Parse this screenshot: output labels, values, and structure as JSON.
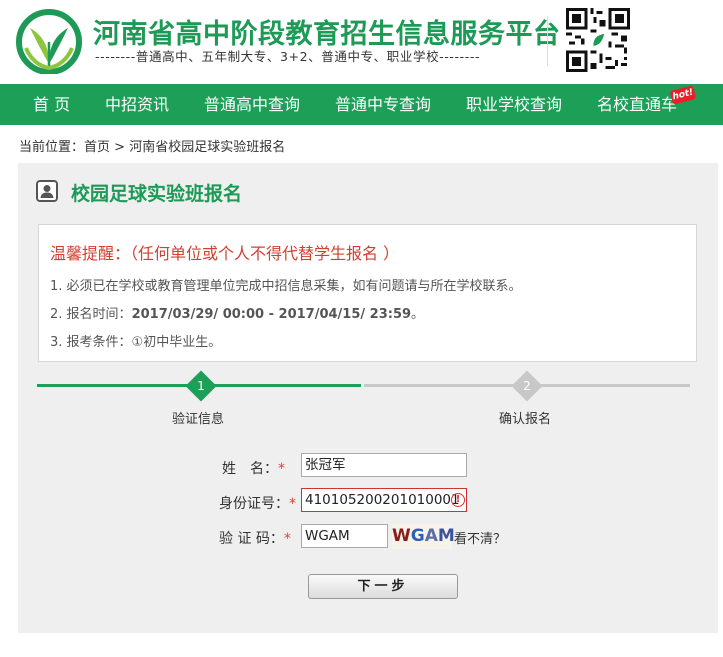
{
  "header": {
    "title": "河南省高中阶段教育招生信息服务平台",
    "subtitle": "--------普通高中、五年制大专、3+2、普通中专、职业学校--------",
    "logo_icon": "leaf-logo-icon",
    "qr_icon": "qr-code-icon"
  },
  "nav": {
    "items": [
      {
        "label": "首 页"
      },
      {
        "label": "中招资讯"
      },
      {
        "label": "普通高中查询"
      },
      {
        "label": "普通中专查询"
      },
      {
        "label": "职业学校查询"
      },
      {
        "label": "名校直通车"
      }
    ],
    "hot_badge": "hot!"
  },
  "breadcrumb": {
    "prefix": "当前位置：",
    "home": "首页",
    "separator": " > ",
    "current": "河南省校园足球实验班报名"
  },
  "page": {
    "title": "校园足球实验班报名"
  },
  "notice": {
    "title": "温馨提醒：（任何单位或个人不得代替学生报名 ）",
    "lines": [
      {
        "num": "1.",
        "text": "必须已在学校或教育管理单位完成中招信息采集，如有问题请与所在学校联系。",
        "bold": ""
      },
      {
        "num": "2.",
        "text": "报名时间：",
        "bold": "2017/03/29/ 00:00 - 2017/04/15/ 23:59",
        "suffix": "。"
      },
      {
        "num": "3.",
        "text": "报考条件：①初中毕业生。",
        "bold": ""
      }
    ]
  },
  "steps": [
    {
      "num": "1",
      "label": "验证信息",
      "active": true
    },
    {
      "num": "2",
      "label": "确认报名",
      "active": false
    }
  ],
  "form": {
    "name_label": "姓　名：",
    "name_value": "张冠军",
    "id_label": "身份证号：",
    "id_value": "410105200201010001",
    "code_label": "验 证 码：",
    "code_value": "WGAM",
    "required_mark": "*",
    "captcha_chars": [
      "W",
      "G",
      "A",
      "M"
    ],
    "refresh_label": "看不清？",
    "next_label": "下一步"
  },
  "colors": {
    "brand_green": "#1e9f57",
    "alert_red": "#d23f31",
    "step_inactive": "#c8c8c8"
  }
}
